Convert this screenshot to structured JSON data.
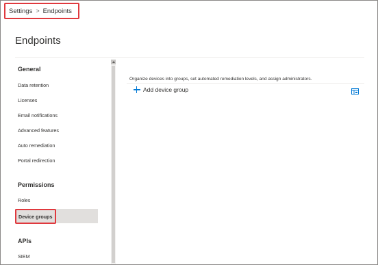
{
  "breadcrumb": {
    "root": "Settings",
    "separator": ">",
    "current": "Endpoints"
  },
  "page": {
    "title": "Endpoints"
  },
  "sidebar": {
    "sections": [
      {
        "header": "General",
        "items": [
          "Data retention",
          "Licenses",
          "Email notifications",
          "Advanced features",
          "Auto remediation",
          "Portal redirection"
        ]
      },
      {
        "header": "Permissions",
        "items": [
          "Roles",
          "Device groups"
        ]
      },
      {
        "header": "APIs",
        "items": [
          "SIEM"
        ]
      }
    ],
    "selected_item": "Device groups"
  },
  "main": {
    "description": "Organize devices into groups, set automated remediation levels, and assign administrators.",
    "add_button_label": "Add device group",
    "add_icon": "plus-icon",
    "customize_icon": "customize-columns-icon",
    "accent_color": "#0078d4"
  },
  "colors": {
    "highlight_outline": "#e0393e",
    "selected_background": "#e1dfdd"
  }
}
